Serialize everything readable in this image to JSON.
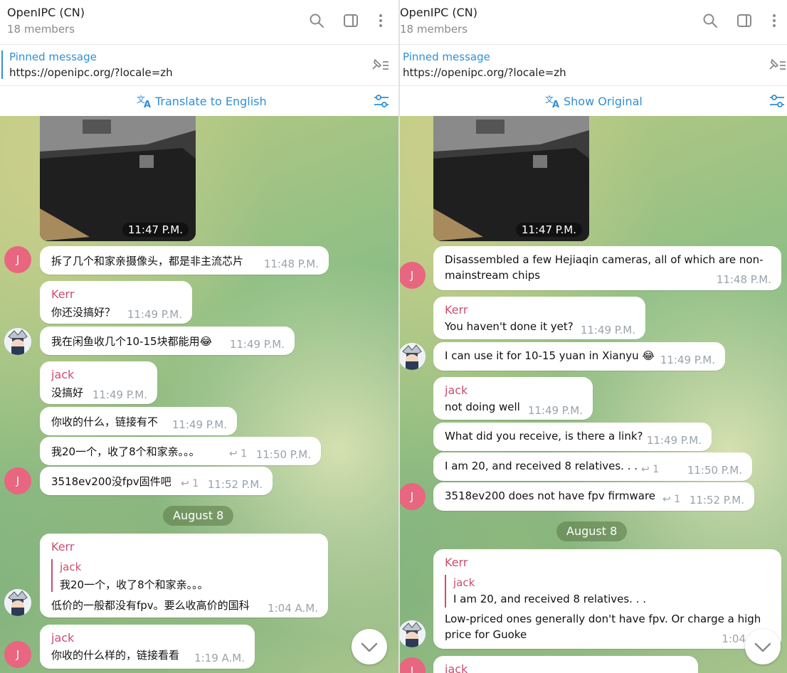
{
  "left": {
    "header": {
      "title": "OpenIPC (CN)",
      "subtitle": "18 members"
    },
    "pinned": {
      "title": "Pinned message",
      "text": "https://openipc.org/?locale=zh"
    },
    "translate": {
      "label": "Translate to English"
    },
    "photo_time": "11:47 P.M.",
    "avatar_letter": "J",
    "messages": [
      {
        "text": "拆了几个和家亲摄像头，都是非主流芯片",
        "time": "11:48 P.M."
      },
      {
        "sender": "Kerr",
        "text": "你还没搞好？",
        "time": "11:49 P.M."
      },
      {
        "text": "我在闲鱼收几个10-15块都能用😂",
        "time": "11:49 P.M."
      },
      {
        "sender": "jack",
        "text": "没搞好",
        "time": "11:49 P.M."
      },
      {
        "text": "你收的什么，链接有不",
        "time": "11:49 P.M."
      },
      {
        "text": "我20一个，收了8个和家亲。。。",
        "replies": "1",
        "time": "11:50 P.M."
      },
      {
        "text": "3518ev200没fpv固件吧",
        "replies": "1",
        "time": "11:52 P.M."
      },
      {
        "sender": "Kerr",
        "quote_sender": "jack",
        "quote_text": "我20一个，收了8个和家亲。。。",
        "text": "低价的一般都没有fpv。要么收高价的国科",
        "time": "1:04 A.M."
      },
      {
        "sender": "jack",
        "text": "你收的什么样的，链接看看",
        "time": "1:19 A.M."
      }
    ],
    "date": "August 8"
  },
  "right": {
    "header": {
      "title": "OpenIPC (CN)",
      "subtitle": "18 members"
    },
    "pinned": {
      "title": "Pinned message",
      "text": "https://openipc.org/?locale=zh"
    },
    "translate": {
      "label": "Show Original"
    },
    "photo_time": "11:47 P.M.",
    "avatar_letter": "J",
    "messages": [
      {
        "text_line1": "Disassembled a few Hejiaqin cameras, all of which are non-",
        "text_line2": "mainstream chips",
        "time": "11:48 P.M."
      },
      {
        "sender": "Kerr",
        "text": "You haven't done it yet?",
        "time": "11:49 P.M."
      },
      {
        "text": "I can use it for 10-15 yuan in Xianyu 😂",
        "time": "11:49 P.M."
      },
      {
        "sender": "jack",
        "text": "not doing well",
        "time": "11:49 P.M."
      },
      {
        "text": "What did you receive, is there a link?",
        "time": "11:49 P.M."
      },
      {
        "text": "I am 20, and received 8 relatives. . .",
        "replies": "1",
        "time": "11:50 P.M."
      },
      {
        "text": "3518ev200 does not have fpv firmware",
        "replies": "1",
        "time": "11:52 P.M."
      },
      {
        "sender": "Kerr",
        "quote_sender": "jack",
        "quote_text": "I am 20, and received 8 relatives. . .",
        "text_line1": "Low-priced ones generally don't have fpv. Or charge a high",
        "text_line2": "price for Guoke",
        "time": "1:04"
      },
      {
        "sender": "jack"
      }
    ],
    "date": "August 8"
  }
}
